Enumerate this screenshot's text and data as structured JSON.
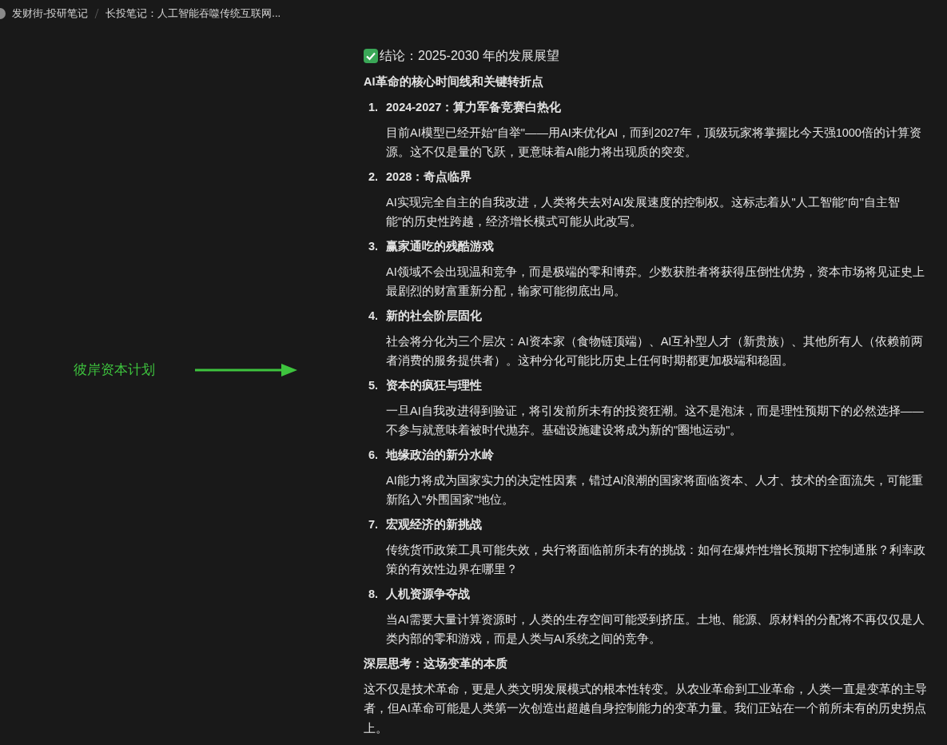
{
  "breadcrumb": [
    {
      "label": "发财街-投研笔记"
    },
    {
      "label": "长投笔记：人工智能吞噬传统互联网..."
    }
  ],
  "annotation": {
    "label": "彼岸资本计划"
  },
  "title": "结论：2025-2030 年的发展展望",
  "subtitle": "AI革命的核心时间线和关键转折点",
  "items": [
    {
      "number": "1.",
      "heading": "2024-2027：算力军备竞赛白热化",
      "text": "目前AI模型已经开始\"自举\"——用AI来优化AI，而到2027年，顶级玩家将掌握比今天强1000倍的计算资源。这不仅是量的飞跃，更意味着AI能力将出现质的突变。"
    },
    {
      "number": "2.",
      "heading": "2028：奇点临界",
      "text": "AI实现完全自主的自我改进，人类将失去对AI发展速度的控制权。这标志着从\"人工智能\"向\"自主智能\"的历史性跨越，经济增长模式可能从此改写。"
    },
    {
      "number": "3.",
      "heading": "赢家通吃的残酷游戏",
      "text": "AI领域不会出现温和竞争，而是极端的零和博弈。少数获胜者将获得压倒性优势，资本市场将见证史上最剧烈的财富重新分配，输家可能彻底出局。"
    },
    {
      "number": "4.",
      "heading": "新的社会阶层固化",
      "text": "社会将分化为三个层次：AI资本家（食物链顶端）、AI互补型人才（新贵族）、其他所有人（依赖前两者消费的服务提供者）。这种分化可能比历史上任何时期都更加极端和稳固。"
    },
    {
      "number": "5.",
      "heading": "资本的疯狂与理性",
      "text": "一旦AI自我改进得到验证，将引发前所未有的投资狂潮。这不是泡沫，而是理性预期下的必然选择——不参与就意味着被时代抛弃。基础设施建设将成为新的\"圈地运动\"。"
    },
    {
      "number": "6.",
      "heading": "地缘政治的新分水岭",
      "text": "AI能力将成为国家实力的决定性因素，错过AI浪潮的国家将面临资本、人才、技术的全面流失，可能重新陷入\"外围国家\"地位。"
    },
    {
      "number": "7.",
      "heading": "宏观经济的新挑战",
      "text": "传统货币政策工具可能失效，央行将面临前所未有的挑战：如何在爆炸性增长预期下控制通胀？利率政策的有效性边界在哪里？"
    },
    {
      "number": "8.",
      "heading": "人机资源争夺战",
      "text": "当AI需要大量计算资源时，人类的生存空间可能受到挤压。土地、能源、原材料的分配将不再仅仅是人类内部的零和游戏，而是人类与AI系统之间的竞争。"
    }
  ],
  "closing": {
    "heading": "深层思考：这场变革的本质",
    "text": "这不仅是技术革命，更是人类文明发展模式的根本性转变。从农业革命到工业革命，人类一直是变革的主导者，但AI革命可能是人类第一次创造出超越自身控制能力的变革力量。我们正站在一个前所未有的历史拐点上。"
  }
}
